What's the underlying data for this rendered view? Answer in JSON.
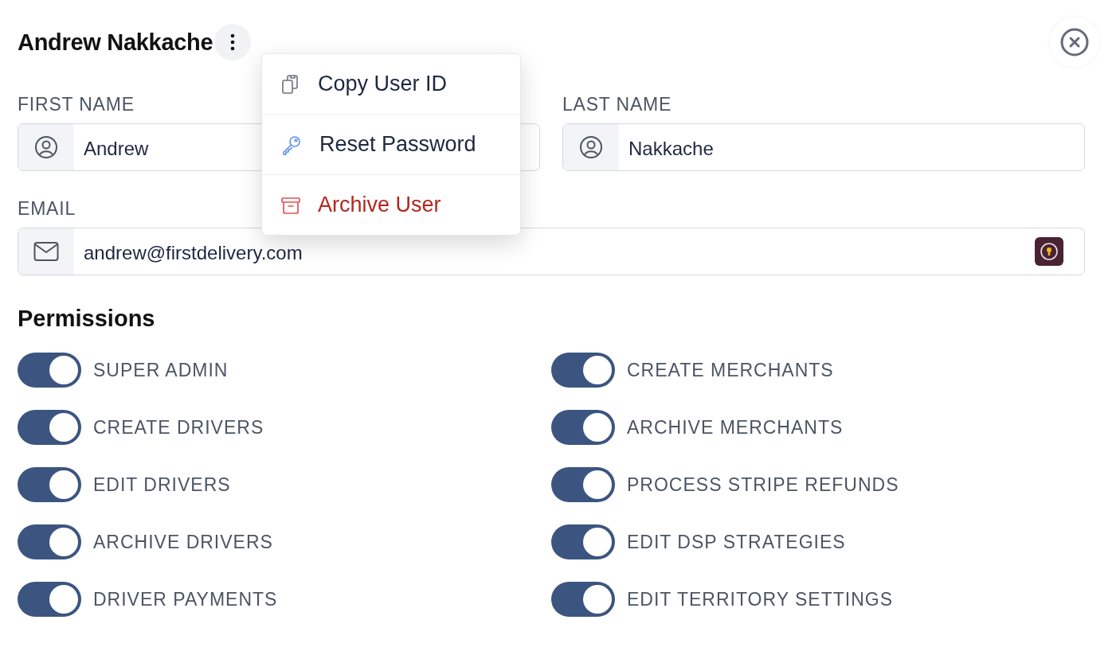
{
  "title": "Andrew Nakkache",
  "menu": [
    {
      "label": "Copy User ID",
      "kind": "normal"
    },
    {
      "label": "Reset Password",
      "kind": "normal"
    },
    {
      "label": "Archive User",
      "kind": "danger"
    }
  ],
  "name_fields": [
    {
      "label": "FIRST NAME",
      "value": "Andrew"
    },
    {
      "label": "LAST NAME",
      "value": "Nakkache"
    }
  ],
  "email_field": {
    "label": "EMAIL",
    "value": "andrew@firstdelivery.com"
  },
  "permissions": {
    "heading": "Permissions",
    "columns": [
      [
        {
          "label": "SUPER ADMIN",
          "on": true
        },
        {
          "label": "CREATE DRIVERS",
          "on": true
        },
        {
          "label": "EDIT DRIVERS",
          "on": true
        },
        {
          "label": "ARCHIVE DRIVERS",
          "on": true
        },
        {
          "label": "DRIVER PAYMENTS",
          "on": true
        }
      ],
      [
        {
          "label": "CREATE MERCHANTS",
          "on": true
        },
        {
          "label": "ARCHIVE MERCHANTS",
          "on": true
        },
        {
          "label": "PROCESS STRIPE REFUNDS",
          "on": true
        },
        {
          "label": "EDIT DSP STRATEGIES",
          "on": true
        },
        {
          "label": "EDIT TERRITORY SETTINGS",
          "on": true
        }
      ]
    ]
  }
}
